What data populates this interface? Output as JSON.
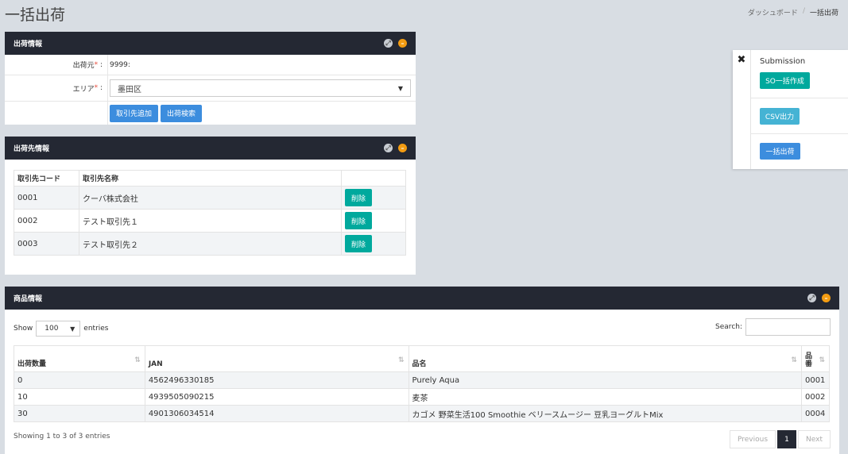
{
  "page": {
    "title": "一括出荷",
    "breadcrumb": [
      "ダッシュボード",
      "/",
      "一括出荷"
    ]
  },
  "shipment_info": {
    "title": "出荷情報",
    "source_label": "出荷元",
    "source_value": "9999:",
    "area_label": "エリア",
    "area_value": "墨田区",
    "required_mark": "*",
    "colon": ":",
    "add_partner_button": "取引先追加",
    "search_button": "出荷検索"
  },
  "destination_info": {
    "title": "出荷先情報",
    "columns": [
      "取引先コード",
      "取引先名称",
      ""
    ],
    "delete_label": "削除",
    "rows": [
      {
        "code": "0001",
        "name": "クーバ株式会社"
      },
      {
        "code": "0002",
        "name": "テスト取引先１"
      },
      {
        "code": "0003",
        "name": "テスト取引先２"
      }
    ]
  },
  "submission": {
    "close_icon": "✖",
    "title": "Submission",
    "so_button": "SO一括作成",
    "csv_button": "CSV出力",
    "ship_button": "一括出荷"
  },
  "product_info": {
    "title": "商品情報",
    "show_label": "Show",
    "page_length": "100",
    "entries_label": "entries",
    "search_label": "Search:",
    "search_value": "",
    "columns": [
      "出荷数量",
      "JAN",
      "品名",
      "品番"
    ],
    "rows": [
      {
        "qty": "0",
        "jan": "4562496330185",
        "name": "Purely Aqua",
        "code": "0001"
      },
      {
        "qty": "10",
        "jan": "4939505090215",
        "name": "麦茶",
        "code": "0002"
      },
      {
        "qty": "30",
        "jan": "4901306034514",
        "name": "カゴメ 野菜生活100 Smoothie ベリースムージー 豆乳ヨーグルトMix",
        "code": "0004"
      }
    ],
    "info": "Showing 1 to 3 of 3 entries",
    "pager": {
      "previous": "Previous",
      "current": "1",
      "next": "Next"
    }
  },
  "colors": {
    "panel_header": "#242833",
    "primary_blue": "#3c8dde",
    "teal": "#00a99d",
    "cyan": "#45b3d4",
    "orange": "#f39c12"
  }
}
